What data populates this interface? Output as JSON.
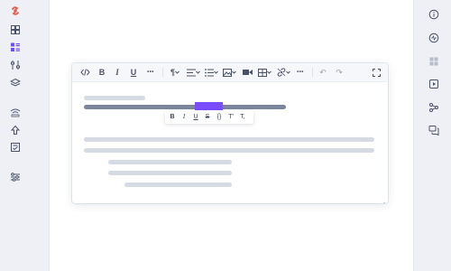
{
  "left_sidebar": {
    "icons": [
      "logo-icon",
      "dashboard-icon",
      "blocks-icon",
      "sliders-icon",
      "layers-icon",
      "wifi-icon",
      "upload-icon",
      "checklist-icon",
      "settings-sliders-icon"
    ]
  },
  "right_sidebar": {
    "icons": [
      "info-icon",
      "activity-icon",
      "grid-icon",
      "video-icon",
      "share-icon",
      "chat-icon"
    ]
  },
  "editor": {
    "toolbar": [
      {
        "name": "code-icon"
      },
      {
        "name": "bold-button",
        "label": "B"
      },
      {
        "name": "italic-button",
        "label": "I"
      },
      {
        "name": "underline-button",
        "label": "U"
      },
      {
        "name": "more-icon",
        "label": "•••"
      },
      {
        "name": "paragraph-button",
        "label": "¶"
      },
      {
        "name": "align-icon"
      },
      {
        "name": "list-icon"
      },
      {
        "name": "image-icon"
      },
      {
        "name": "video-icon"
      },
      {
        "name": "table-icon"
      },
      {
        "name": "link-icon"
      },
      {
        "name": "more-icon-2",
        "label": "•••"
      },
      {
        "name": "undo-icon",
        "label": "↶"
      },
      {
        "name": "redo-icon",
        "label": "↷"
      },
      {
        "name": "fullscreen-icon"
      }
    ],
    "bubble_menu": [
      "B",
      "I",
      "U",
      "S",
      "{}",
      "T'",
      "T,"
    ],
    "accent_color": "#7a4dff"
  }
}
